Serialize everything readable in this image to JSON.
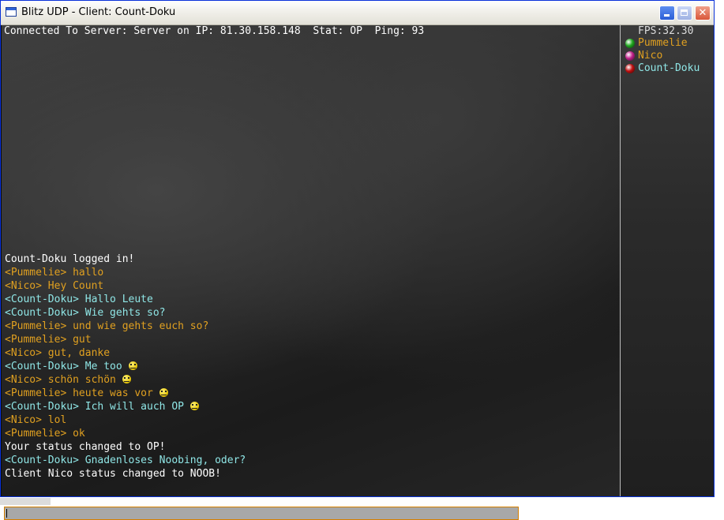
{
  "window": {
    "title": "Blitz UDP - Client: Count-Doku",
    "minimize": "",
    "maximize": "",
    "close": "✕"
  },
  "status": {
    "text": "Connected To Server: Server on IP: 81.30.158.148  Stat: OP  Ping: 93"
  },
  "sidebar": {
    "fps": "FPS:32.30",
    "players": [
      {
        "name": "Pummelie",
        "color": "#e0a020",
        "dot": "#1fa81f"
      },
      {
        "name": "Nico",
        "color": "#e0a020",
        "dot": "#c0208a"
      },
      {
        "name": "Count-Doku",
        "color": "#8fe6e6",
        "dot": "#c01010"
      }
    ]
  },
  "chat": {
    "colors": {
      "system": "#ffffff",
      "pummelie": "#e0a020",
      "nico": "#e0a020",
      "doku": "#8fe6e6"
    },
    "lines": [
      {
        "text": "Count-Doku logged in!",
        "kind": "system",
        "smiley": false
      },
      {
        "text": "<Pummelie> hallo",
        "kind": "pummelie",
        "smiley": false
      },
      {
        "text": "<Nico> Hey Count",
        "kind": "nico",
        "smiley": false
      },
      {
        "text": "<Count-Doku> Hallo Leute",
        "kind": "doku",
        "smiley": false
      },
      {
        "text": "<Count-Doku> Wie gehts so?",
        "kind": "doku",
        "smiley": false
      },
      {
        "text": "<Pummelie> und wie gehts euch so?",
        "kind": "pummelie",
        "smiley": false
      },
      {
        "text": "<Pummelie> gut",
        "kind": "pummelie",
        "smiley": false
      },
      {
        "text": "<Nico> gut, danke",
        "kind": "nico",
        "smiley": false
      },
      {
        "text": "<Count-Doku> Me too",
        "kind": "doku",
        "smiley": true
      },
      {
        "text": "<Nico> schön schön",
        "kind": "nico",
        "smiley": true
      },
      {
        "text": "<Pummelie> heute was vor",
        "kind": "pummelie",
        "smiley": true
      },
      {
        "text": "<Count-Doku> Ich will auch OP",
        "kind": "doku",
        "smiley": true
      },
      {
        "text": "<Nico> lol",
        "kind": "nico",
        "smiley": false
      },
      {
        "text": "<Pummelie> ok",
        "kind": "pummelie",
        "smiley": false
      },
      {
        "text": "Your status changed to OP!",
        "kind": "system",
        "smiley": false
      },
      {
        "text": "<Count-Doku> Gnadenloses Noobing, oder?",
        "kind": "doku",
        "smiley": false
      },
      {
        "text": "Client Nico status changed to NOOB!",
        "kind": "system",
        "smiley": false
      }
    ]
  },
  "input": {
    "value": ""
  }
}
